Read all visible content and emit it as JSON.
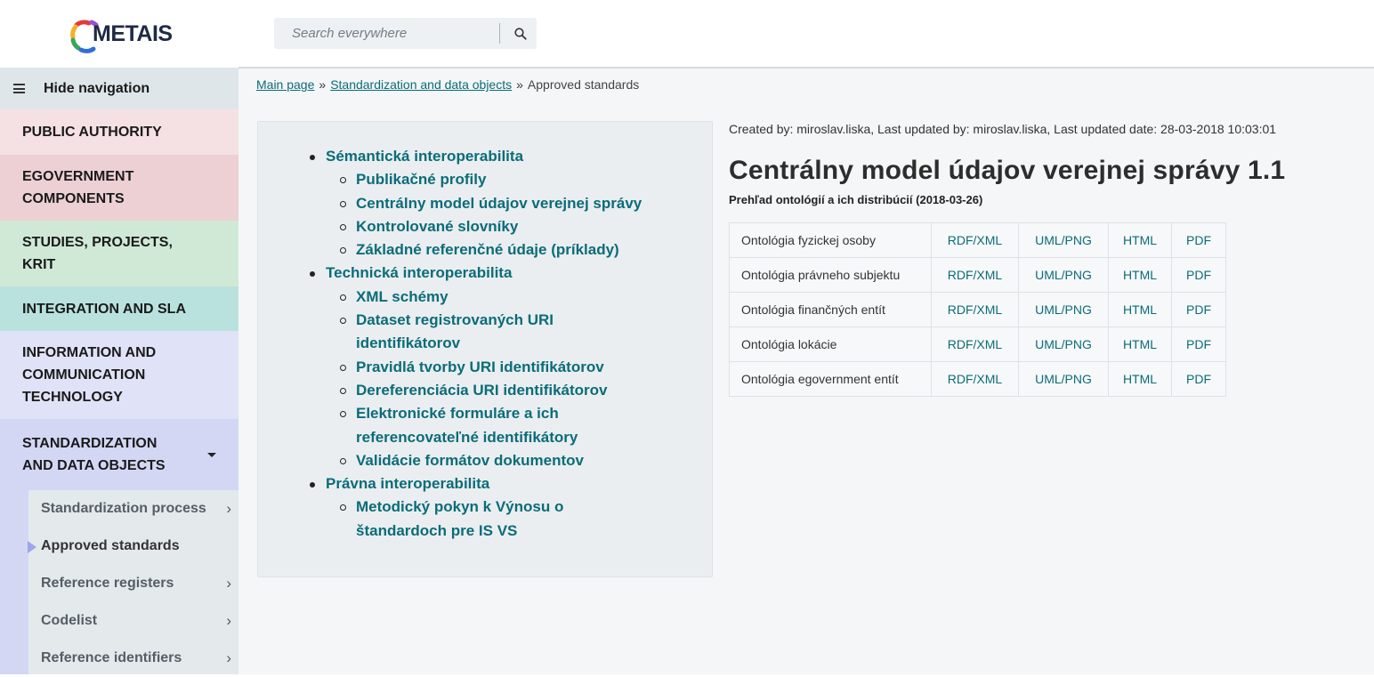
{
  "header": {
    "logo_text": "METAIS",
    "search": {
      "placeholder": "Search everywhere",
      "icon": "search-icon"
    }
  },
  "sidebar": {
    "toggle_label": "Hide navigation",
    "toggle_icon": "hamburger-icon",
    "items": [
      {
        "label": "PUBLIC AUTHORITY",
        "color": "#f5e1e3"
      },
      {
        "label": "EGOVERNMENT COMPONENTS",
        "color": "#ecd0d4"
      },
      {
        "label": "STUDIES, PROJECTS, KRIT",
        "color": "#cfe9d6"
      },
      {
        "label": "INTEGRATION AND SLA",
        "color": "#b9e2df"
      },
      {
        "label": "INFORMATION AND COMMUNICATION TECHNOLOGY",
        "color": "#e0e3f7"
      },
      {
        "label": "STANDARDIZATION AND DATA OBJECTS",
        "color": "#d4d7f4",
        "expanded": true
      }
    ],
    "subitems": [
      {
        "label": "Standardization process",
        "has_chevron": true
      },
      {
        "label": "Approved standards",
        "active": true
      },
      {
        "label": "Reference registers",
        "has_chevron": true
      },
      {
        "label": "Codelist",
        "has_chevron": true
      },
      {
        "label": "Reference identifiers",
        "has_chevron": true
      }
    ],
    "chevron": "›"
  },
  "breadcrumb": {
    "items": [
      "Main page",
      "Standardization and data objects"
    ],
    "current": "Approved standards",
    "separator": "»"
  },
  "toc": {
    "sections": [
      {
        "label": "Sémantická interoperabilita",
        "children": [
          "Publikačné profily",
          "Centrálny model údajov verejnej správy",
          "Kontrolované slovníky",
          "Základné referenčné údaje (príklady)"
        ]
      },
      {
        "label": "Technická interoperabilita",
        "children": [
          "XML schémy",
          "Dataset registrovaných URI identifikátorov",
          "Pravidlá tvorby URI identifikátorov",
          "Dereferenciácia URI identifikátorov",
          "Elektronické formuláre a ich referencovateľné identifikátory",
          "Validácie formátov dokumentov"
        ]
      },
      {
        "label": "Právna interoperabilita",
        "children": [
          "Metodický pokyn k Výnosu o štandardoch pre IS VS"
        ]
      }
    ]
  },
  "content": {
    "meta": "Created by: miroslav.liska, Last updated by: miroslav.liska, Last updated date: 28-03-2018 10:03:01",
    "title": "Centrálny model údajov verejnej správy 1.1",
    "subtitle": "Prehľad ontológií a ich distribúcií (2018-03-26)",
    "table": {
      "rows": [
        {
          "name": "Ontológia fyzickej osoby",
          "links": [
            "RDF/XML",
            "UML/PNG",
            "HTML",
            "PDF"
          ]
        },
        {
          "name": "Ontológia právneho subjektu",
          "links": [
            "RDF/XML",
            "UML/PNG",
            "HTML",
            "PDF"
          ]
        },
        {
          "name": "Ontológia finančných entít",
          "links": [
            "RDF/XML",
            "UML/PNG",
            "HTML",
            "PDF"
          ]
        },
        {
          "name": "Ontológia lokácie",
          "links": [
            "RDF/XML",
            "UML/PNG",
            "HTML",
            "PDF"
          ]
        },
        {
          "name": "Ontológia egovernment entít",
          "links": [
            "RDF/XML",
            "UML/PNG",
            "HTML",
            "PDF"
          ]
        }
      ]
    }
  },
  "colors": {
    "link": "#0b6c78",
    "sidebar_active_marker": "#9fa4ef"
  }
}
